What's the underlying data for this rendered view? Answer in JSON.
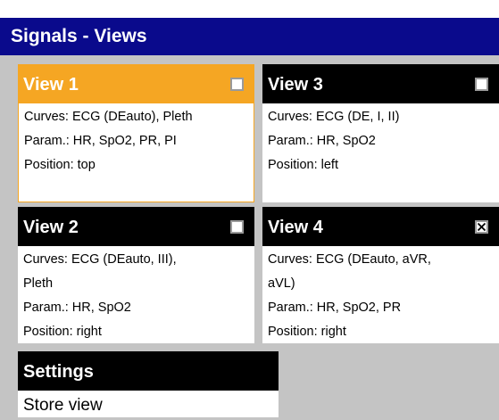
{
  "window": {
    "title": "Signals - Views"
  },
  "views": [
    {
      "title": "View 1",
      "selected": true,
      "checked": false,
      "lines": [
        "Curves: ECG (DEauto), Pleth",
        "Param.: HR, SpO2, PR, PI",
        "Position: top"
      ]
    },
    {
      "title": "View 3",
      "selected": false,
      "checked": false,
      "lines": [
        "Curves: ECG (DE, I, II)",
        "Param.: HR, SpO2",
        "Position: left"
      ]
    },
    {
      "title": "View 2",
      "selected": false,
      "checked": false,
      "lines": [
        "Curves: ECG (DEauto, III),",
        "Pleth",
        "Param.: HR, SpO2",
        "Position: right"
      ]
    },
    {
      "title": "View 4",
      "selected": false,
      "checked": true,
      "lines": [
        "Curves: ECG (DEauto, aVR,",
        "aVL)",
        "Param.: HR, SpO2, PR",
        "Position: right"
      ]
    }
  ],
  "settings": {
    "header": "Settings",
    "items": [
      "Store view"
    ]
  },
  "colors": {
    "title_bar": "#0a0a8c",
    "selected_header": "#f5a623",
    "panel_bg": "#c4c4c4"
  }
}
